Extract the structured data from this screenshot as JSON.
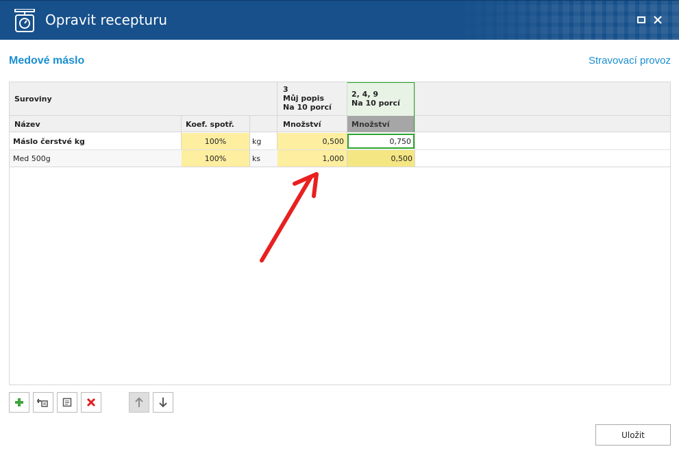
{
  "window": {
    "title": "Opravit recepturu",
    "accent_color": "#17508b"
  },
  "header": {
    "title": "Medové máslo",
    "context_link": "Stravovací provoz"
  },
  "grid": {
    "group_header": "Suroviny",
    "columns": {
      "name": "Název",
      "coefficient": "Koef. spotř.",
      "unit": ""
    },
    "recipe_columns": [
      {
        "line1": "3",
        "line2": "Můj popis",
        "line3": "Na 10 porcí",
        "quantity_header": "Množství",
        "selected": false
      },
      {
        "line1": "2, 4, 9",
        "line2": "Na 10 porcí",
        "line3": "",
        "quantity_header": "Množství",
        "selected": true
      }
    ],
    "rows": [
      {
        "name": "Máslo čerstvé kg",
        "coefficient": "100%",
        "unit": "kg",
        "qty1": "0,500",
        "qty2": "0,750",
        "bold": true,
        "editing": true
      },
      {
        "name": "Med 500g",
        "coefficient": "100%",
        "unit": "ks",
        "qty1": "1,000",
        "qty2": "0,500",
        "bold": false,
        "editing": false
      }
    ],
    "highlight_color": "#fdeea0",
    "selection_color": "#2aa52a"
  },
  "toolbar": {
    "add_icon": "plus-icon",
    "add_sub_icon": "add-subrecipe-icon",
    "edit_icon": "document-icon",
    "delete_icon": "delete-x-icon",
    "move_up_icon": "arrow-up-icon",
    "move_down_icon": "arrow-down-icon"
  },
  "footer": {
    "save_label": "Uložit"
  }
}
